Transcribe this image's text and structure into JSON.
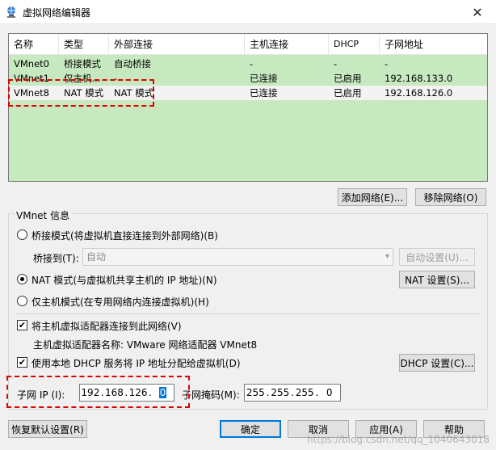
{
  "window": {
    "title": "虚拟网络编辑器",
    "close_glyph": "✕"
  },
  "table": {
    "headers": [
      "名称",
      "类型",
      "外部连接",
      "主机连接",
      "DHCP",
      "子网地址"
    ],
    "rows": [
      [
        "VMnet0",
        "桥接模式",
        "自动桥接",
        "-",
        "-",
        "-"
      ],
      [
        "VMnet1",
        "仅主机...",
        "-",
        "已连接",
        "已启用",
        "192.168.133.0"
      ],
      [
        "VMnet8",
        "NAT 模式",
        "NAT 模式",
        "已连接",
        "已启用",
        "192.168.126.0"
      ]
    ],
    "selected_row": 2
  },
  "buttons": {
    "add_network": "添加网络(E)...",
    "remove_network": "移除网络(O)",
    "auto_settings": "自动设置(U)...",
    "nat_settings": "NAT 设置(S)...",
    "dhcp_settings": "DHCP 设置(C)...",
    "restore_defaults": "恢复默认设置(R)",
    "ok": "确定",
    "cancel": "取消",
    "apply": "应用(A)",
    "help": "帮助"
  },
  "vmnet_info": {
    "group_label": "VMnet 信息",
    "bridge_mode": "桥接模式(将虚拟机直接连接到外部网络)(B)",
    "bridge_to_label": "桥接到(T):",
    "bridge_to_value": "自动",
    "nat_mode": "NAT 模式(与虚拟机共享主机的 IP 地址)(N)",
    "host_only_mode": "仅主机模式(在专用网络内连接虚拟机)(H)",
    "selected_mode": "nat",
    "connect_adapter": "将主机虚拟适配器连接到此网络(V)",
    "connect_adapter_checked": true,
    "adapter_name": "主机虚拟适配器名称: VMware 网络适配器 VMnet8",
    "use_dhcp": "使用本地 DHCP 服务将 IP 地址分配给虚拟机(D)",
    "use_dhcp_checked": true,
    "subnet_ip_label": "子网 IP (I):",
    "subnet_ip": [
      "192",
      "168",
      "126",
      "0"
    ],
    "subnet_mask_label": "子网掩码(M):",
    "subnet_mask": [
      "255",
      "255",
      "255",
      "0"
    ]
  },
  "watermark": "https://blog.csdn.net/qq_1040643018",
  "colors": {
    "list_bg": "#c7e9c0",
    "accent": "#0078d7",
    "highlight": "#e00000"
  }
}
